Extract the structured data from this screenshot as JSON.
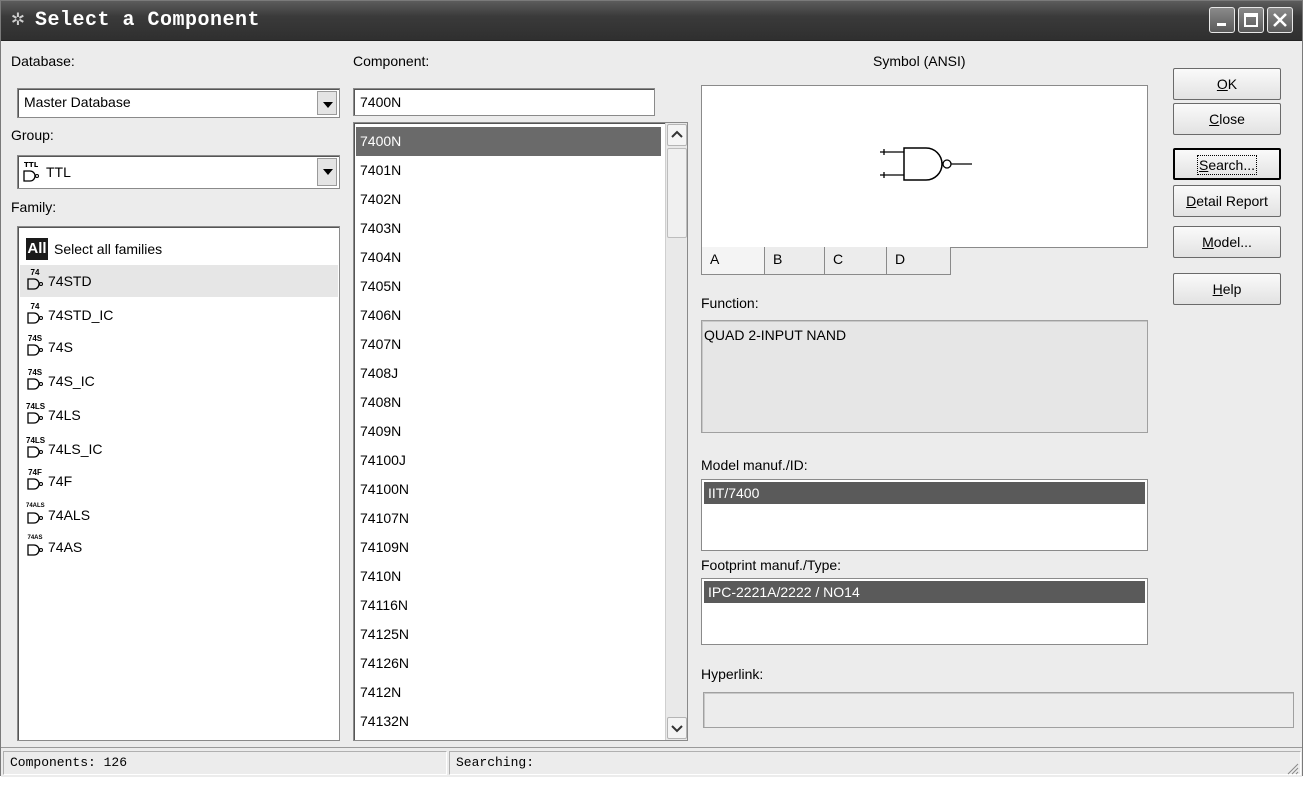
{
  "window": {
    "title": "Select a Component",
    "controls": {
      "minimize": "minimize",
      "maximize": "maximize",
      "close": "close"
    }
  },
  "database": {
    "label": "Database:",
    "value": "Master Database"
  },
  "group": {
    "label": "Group:",
    "icon_text": "TTL",
    "value": "TTL"
  },
  "family": {
    "label": "Family:",
    "items": [
      {
        "label": "Select all families",
        "icon": "All",
        "selected": false
      },
      {
        "label": "74STD",
        "icon": "74",
        "selected": true
      },
      {
        "label": "74STD_IC",
        "icon": "74",
        "selected": false
      },
      {
        "label": "74S",
        "icon": "74S",
        "selected": false
      },
      {
        "label": "74S_IC",
        "icon": "74S",
        "selected": false
      },
      {
        "label": "74LS",
        "icon": "74LS",
        "selected": false
      },
      {
        "label": "74LS_IC",
        "icon": "74LS",
        "selected": false
      },
      {
        "label": "74F",
        "icon": "74F",
        "selected": false
      },
      {
        "label": "74ALS",
        "icon": "74ALS",
        "selected": false
      },
      {
        "label": "74AS",
        "icon": "74AS",
        "selected": false
      }
    ]
  },
  "component": {
    "label": "Component:",
    "value": "7400N",
    "items": [
      "7400N",
      "7401N",
      "7402N",
      "7403N",
      "7404N",
      "7405N",
      "7406N",
      "7407N",
      "7408J",
      "7408N",
      "7409N",
      "74100J",
      "74100N",
      "74107N",
      "74109N",
      "7410N",
      "74116N",
      "74125N",
      "74126N",
      "7412N",
      "74132N"
    ],
    "selected_index": 0
  },
  "symbol": {
    "label": "Symbol (ANSI)",
    "tabs": [
      "A",
      "B",
      "C",
      "D"
    ],
    "active_tab": "A"
  },
  "function": {
    "label": "Function:",
    "value": "QUAD 2-INPUT NAND"
  },
  "model": {
    "label": "Model manuf./ID:",
    "value": "IIT/7400"
  },
  "footprint": {
    "label": "Footprint manuf./Type:",
    "value": "IPC-2221A/2222 / NO14"
  },
  "hyperlink": {
    "label": "Hyperlink:",
    "value": ""
  },
  "buttons": {
    "ok": "OK",
    "close": "Close",
    "search": "Search...",
    "detail_report": "Detail Report",
    "model": "Model...",
    "help": "Help"
  },
  "status": {
    "components": "Components: 126",
    "searching": "Searching:"
  }
}
